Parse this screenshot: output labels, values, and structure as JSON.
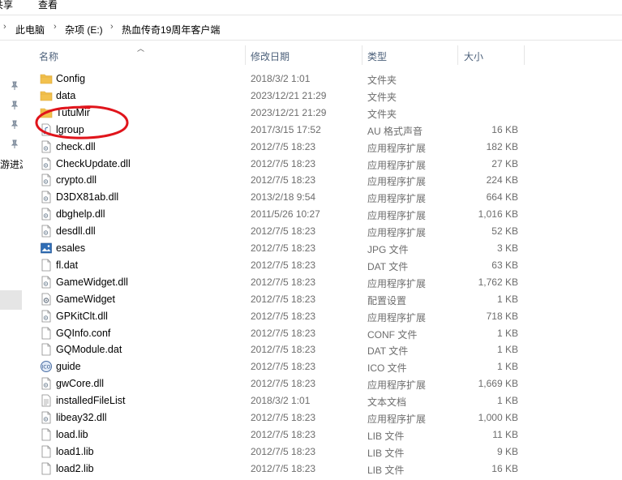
{
  "ribbon": {
    "share_label": "共享",
    "view_label": "查看"
  },
  "address": {
    "crumbs": [
      "此电脑",
      "杂项 (E:)",
      "热血传奇19周年客户端"
    ],
    "separator": "›"
  },
  "navpane": {
    "partial_label": "游进游"
  },
  "columns": {
    "name": "名称",
    "date": "修改日期",
    "type": "类型",
    "size": "大小"
  },
  "colors": {
    "folder": "#f2c14e",
    "folder_dark": "#d9a634",
    "annotation": "#e0141b",
    "header_text": "#4c607a"
  },
  "files": [
    {
      "name": "Config",
      "date": "2018/3/2 1:01",
      "type": "文件夹",
      "size": "",
      "icon": "folder-icon"
    },
    {
      "name": "data",
      "date": "2023/12/21 21:29",
      "type": "文件夹",
      "size": "",
      "icon": "folder-icon"
    },
    {
      "name": "TutuMir",
      "date": "2023/12/21 21:29",
      "type": "文件夹",
      "size": "",
      "icon": "folder-icon"
    },
    {
      "name": "lgroup",
      "date": "2017/3/15 17:52",
      "type": "AU 格式声音",
      "size": "16 KB",
      "icon": "audio-file-icon"
    },
    {
      "name": "check.dll",
      "date": "2012/7/5 18:23",
      "type": "应用程序扩展",
      "size": "182 KB",
      "icon": "dll-file-icon"
    },
    {
      "name": "CheckUpdate.dll",
      "date": "2012/7/5 18:23",
      "type": "应用程序扩展",
      "size": "27 KB",
      "icon": "dll-file-icon"
    },
    {
      "name": "crypto.dll",
      "date": "2012/7/5 18:23",
      "type": "应用程序扩展",
      "size": "224 KB",
      "icon": "dll-file-icon"
    },
    {
      "name": "D3DX81ab.dll",
      "date": "2013/2/18 9:54",
      "type": "应用程序扩展",
      "size": "664 KB",
      "icon": "dll-file-icon"
    },
    {
      "name": "dbghelp.dll",
      "date": "2011/5/26 10:27",
      "type": "应用程序扩展",
      "size": "1,016 KB",
      "icon": "dll-file-icon"
    },
    {
      "name": "desdll.dll",
      "date": "2012/7/5 18:23",
      "type": "应用程序扩展",
      "size": "52 KB",
      "icon": "dll-file-icon"
    },
    {
      "name": "esales",
      "date": "2012/7/5 18:23",
      "type": "JPG 文件",
      "size": "3 KB",
      "icon": "image-file-icon"
    },
    {
      "name": "fl.dat",
      "date": "2012/7/5 18:23",
      "type": "DAT 文件",
      "size": "63 KB",
      "icon": "generic-file-icon"
    },
    {
      "name": "GameWidget.dll",
      "date": "2012/7/5 18:23",
      "type": "应用程序扩展",
      "size": "1,762 KB",
      "icon": "dll-file-icon"
    },
    {
      "name": "GameWidget",
      "date": "2012/7/5 18:23",
      "type": "配置设置",
      "size": "1 KB",
      "icon": "config-file-icon"
    },
    {
      "name": "GPKitClt.dll",
      "date": "2012/7/5 18:23",
      "type": "应用程序扩展",
      "size": "718 KB",
      "icon": "dll-file-icon"
    },
    {
      "name": "GQInfo.conf",
      "date": "2012/7/5 18:23",
      "type": "CONF 文件",
      "size": "1 KB",
      "icon": "generic-file-icon"
    },
    {
      "name": "GQModule.dat",
      "date": "2012/7/5 18:23",
      "type": "DAT 文件",
      "size": "1 KB",
      "icon": "generic-file-icon"
    },
    {
      "name": "guide",
      "date": "2012/7/5 18:23",
      "type": "ICO 文件",
      "size": "1 KB",
      "icon": "ico-file-icon"
    },
    {
      "name": "gwCore.dll",
      "date": "2012/7/5 18:23",
      "type": "应用程序扩展",
      "size": "1,669 KB",
      "icon": "dll-file-icon"
    },
    {
      "name": "installedFileList",
      "date": "2018/3/2 1:01",
      "type": "文本文档",
      "size": "1 KB",
      "icon": "text-file-icon"
    },
    {
      "name": "libeay32.dll",
      "date": "2012/7/5 18:23",
      "type": "应用程序扩展",
      "size": "1,000 KB",
      "icon": "dll-file-icon"
    },
    {
      "name": "load.lib",
      "date": "2012/7/5 18:23",
      "type": "LIB 文件",
      "size": "11 KB",
      "icon": "generic-file-icon"
    },
    {
      "name": "load1.lib",
      "date": "2012/7/5 18:23",
      "type": "LIB 文件",
      "size": "9 KB",
      "icon": "generic-file-icon"
    },
    {
      "name": "load2.lib",
      "date": "2012/7/5 18:23",
      "type": "LIB 文件",
      "size": "16 KB",
      "icon": "generic-file-icon"
    }
  ]
}
